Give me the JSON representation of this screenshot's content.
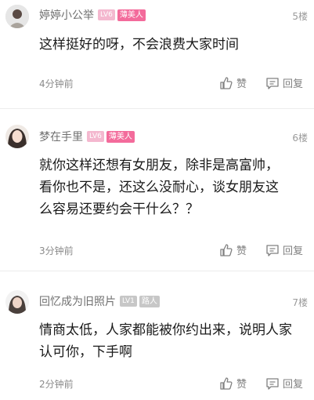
{
  "comments": [
    {
      "username": "婷婷小公举",
      "level": "LV6",
      "badge": "薄美人",
      "floor": "5楼",
      "text": "这样挺好的呀，不会浪费大家时间",
      "time": "4分钟前",
      "like_label": "赞",
      "reply_label": "回复"
    },
    {
      "username": "梦在手里",
      "level": "LV6",
      "badge": "薄美人",
      "floor": "6楼",
      "text": "就你这样还想有女朋友，除非是高富帅，看你也不是，还这么没耐心，谈女朋友这么容易还要约会干什么？？",
      "time": "3分钟前",
      "like_label": "赞",
      "reply_label": "回复"
    },
    {
      "username": "回忆成为旧照片",
      "level": "LV1",
      "badge": "路人",
      "floor": "7楼",
      "text": "情商太低，人家都能被你约出来，说明人家认可你，下手啊",
      "time": "2分钟前",
      "like_label": "赞",
      "reply_label": "回复"
    }
  ]
}
